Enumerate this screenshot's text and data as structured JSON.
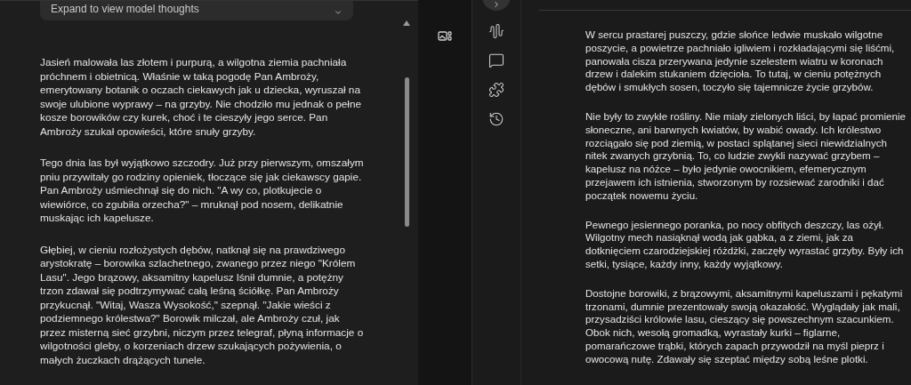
{
  "thoughts": {
    "label": "Expand to view model thoughts",
    "expanded": false
  },
  "left_paragraphs": [
    "Jasień malowała las złotem i purpurą, a wilgotna ziemia pachniała próchnem i obietnicą. Właśnie w taką pogodę Pan Ambroży, emerytowany botanik o oczach ciekawych jak u dziecka, wyruszał na swoje ulubione wyprawy – na grzyby. Nie chodziło mu jednak o pełne kosze borowików czy kurek, choć i te cieszyły jego serce. Pan Ambroży szukał opowieści, które snuły grzyby.",
    "Tego dnia las był wyjątkowo szczodry. Już przy pierwszym, omszałym pniu przywitały go rodziny opieniek, tłoczące się jak ciekawscy gapie. Pan Ambroży uśmiechnął się do nich. \"A wy co, plotkujecie o wiewiórce, co zgubiła orzecha?\" – mruknął pod nosem, delikatnie muskając ich kapelusze.",
    "Głębiej, w cieniu rozłożystych dębów, natknął się na prawdziwego arystokratę – borowika szlachetnego, zwanego przez niego \"Królem Lasu\". Jego brązowy, aksamitny kapelusz lśnił dumnie, a potężny trzon zdawał się podtrzymywać całą leśną ściółkę. Pan Ambroży przykucnął. \"Witaj, Wasza Wysokość,\" szepnął. \"Jakie wieści z podziemnego królestwa?\" Borowik milczał, ale Ambroży czuł, jak przez misterną sieć grzybni, niczym przez telegraf, płyną informacje o wilgotności gleby, o korzeniach drzew szukających pożywienia, o małych żuczkach drążących tunele."
  ],
  "right_paragraphs": [
    "W sercu prastarej puszczy, gdzie słońce ledwie muskało wilgotne poszycie, a powietrze pachniało igliwiem i rozkładającymi się liśćmi, panowała cisza przerywana jedynie szelestem wiatru w koronach drzew i dalekim stukaniem dzięcioła. To tutaj, w cieniu potężnych dębów i smukłych sosen, toczyło się tajemnicze życie grzybów.",
    "Nie były to zwykłe rośliny. Nie miały zielonych liści, by łapać promienie słoneczne, ani barwnych kwiatów, by wabić owady. Ich królestwo rozciągało się pod ziemią, w postaci splątanej sieci niewidzialnych nitek zwanych grzybnią. To, co ludzie zwykli nazywać grzybem – kapelusz na nóżce – było jedynie owocnikiem, efemerycznym przejawem ich istnienia, stworzonym by rozsiewać zarodniki i dać początek nowemu życiu.",
    "Pewnego jesiennego poranka, po nocy obfitych deszczy, las ożył. Wilgotny mech nasiąknął wodą jak gąbka, a z ziemi, jak za dotknięciem czarodziejskiej różdżki, zaczęły wyrastać grzyby. Były ich setki, tysiące, każdy inny, każdy wyjątkowy.",
    "Dostojne borowiki, z brązowymi, aksamitnymi kapeluszami i pękatymi trzonami, dumnie prezentowały swoją okazałość. Wyglądały jak mali, przysadziści królowie lasu, cieszący się powszechnym szacunkiem. Obok nich, wesołą gromadką, wyrastały kurki – figlarne, pomarańczowe trąbki, których zapach przywodził na myśl pieprz i owocową nutę. Zdawały się szeptać między sobą leśne plotki."
  ]
}
